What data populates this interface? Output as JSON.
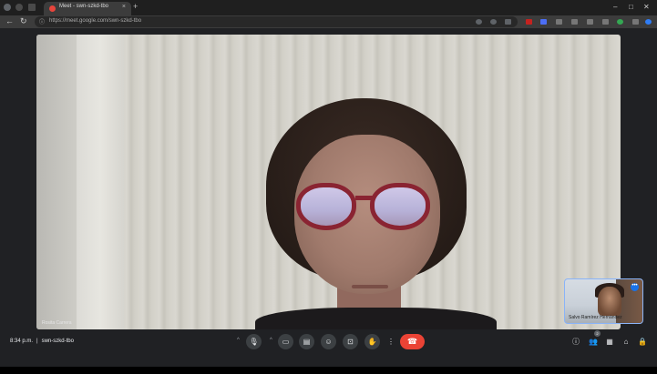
{
  "browser": {
    "tab_title": "Meet - swn-szkd-tbo",
    "tab_close": "×",
    "new_tab": "+",
    "url": "https://meet.google.com/swn-szkd-tbo"
  },
  "meeting": {
    "main_participant_name": "Rosita Carrera",
    "self_name": "Salvo Ramírez Hernández",
    "self_more": "•••",
    "time": "8:34 p.m.",
    "separator": "|",
    "code": "swn-szkd-tbo",
    "people_count": "2"
  },
  "icons": {
    "back": "←",
    "forward": "→",
    "reload": "↻",
    "min": "–",
    "max": "□",
    "close": "✕",
    "caret": "^",
    "mic": "🎙",
    "camera": "▭",
    "captions": "▤",
    "emoji": "☺",
    "present": "⊡",
    "hand": "✋",
    "more": "⋮",
    "leave": "☎",
    "info": "ⓘ",
    "people": "👥",
    "chat": "▦",
    "activities": "⌂",
    "lock": "🔒"
  },
  "colors": {
    "accent": "#8ab4f8",
    "leave_red": "#ea4335",
    "control_bg": "#3c4043",
    "meet_bg": "#202124"
  }
}
